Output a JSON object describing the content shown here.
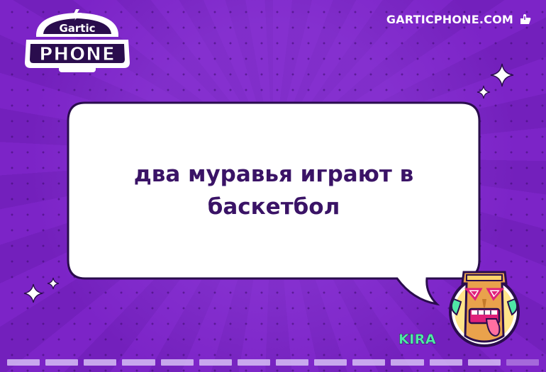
{
  "app": {
    "logo_top_text": "Gartic",
    "logo_bottom_text": "PHONE"
  },
  "header": {
    "site_link_label": "GARTICPHONE.COM",
    "site_link_icon": "hand-pointer-icon"
  },
  "bubble": {
    "text": "два муравья играют в баскетбол"
  },
  "player": {
    "name": "KIRA",
    "avatar_icon": "tiki-mask-avatar"
  },
  "progress": {
    "segments": 14,
    "filled": 13
  },
  "colors": {
    "background": "#7a22c4",
    "bubble_text": "#3a1366",
    "player_name": "#4fe6a6"
  }
}
